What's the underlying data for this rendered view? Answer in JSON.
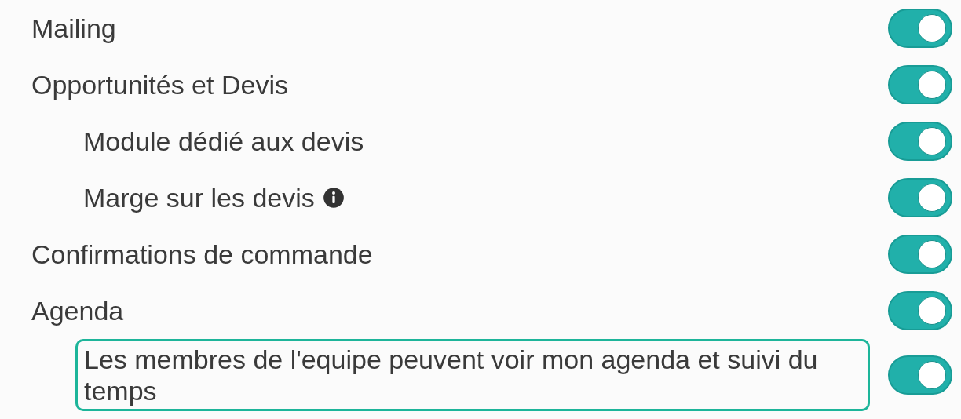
{
  "settings": [
    {
      "label": "Mailing",
      "on": true
    },
    {
      "label": "Opportunités et Devis",
      "on": true,
      "children": [
        {
          "label": "Module dédié aux devis",
          "on": true
        },
        {
          "label": "Marge sur les devis",
          "on": true,
          "info": true
        }
      ]
    },
    {
      "label": "Confirmations de commande",
      "on": true
    },
    {
      "label": "Agenda",
      "on": true,
      "children": [
        {
          "label": "Les membres de l'equipe peuvent voir mon agenda et suivi du temps",
          "on": true,
          "highlighted": true
        }
      ]
    }
  ]
}
